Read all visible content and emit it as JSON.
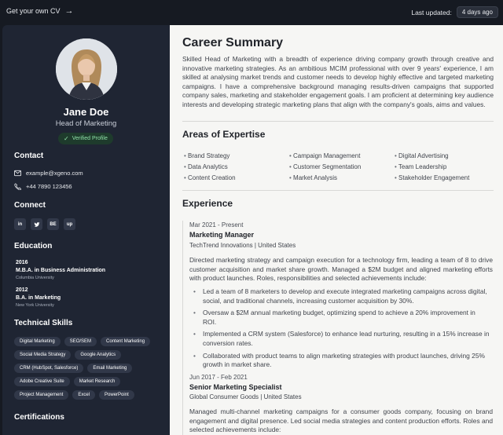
{
  "topbar": {
    "get_cv": "Get your own CV",
    "updated_label": "Last updated:",
    "updated_value": "4 days ago"
  },
  "profile": {
    "name": "Jane Doe",
    "title": "Head of Marketing",
    "verified": "Verified Profile"
  },
  "contact": {
    "heading": "Contact",
    "email": "example@xgeno.com",
    "phone": "+44 7890 123456"
  },
  "connect": {
    "heading": "Connect",
    "links": [
      "in",
      "tw",
      "BE",
      "up"
    ]
  },
  "education": {
    "heading": "Education",
    "items": [
      {
        "year": "2016",
        "degree": "M.B.A. in Business Administration",
        "school": "Columbia University"
      },
      {
        "year": "2012",
        "degree": "B.A. in Marketing",
        "school": "New York University"
      }
    ]
  },
  "skills": {
    "heading": "Technical Skills",
    "items": [
      "Digital Marketing",
      "SEO/SEM",
      "Content Marketing",
      "Social Media Strategy",
      "Google Analytics",
      "CRM (HubSpot, Salesforce)",
      "Email Marketing",
      "Adobe Creative Suite",
      "Market Research",
      "Project Management",
      "Excel",
      "PowerPoint"
    ]
  },
  "certifications": {
    "heading": "Certifications"
  },
  "summary": {
    "heading": "Career Summary",
    "text": "Skilled Head of Marketing with a breadth of experience driving company growth through creative and innovative marketing strategies. As an ambitious MCIM professional with over 9 years' experience, I am skilled at analysing market trends and customer needs to develop highly effective and targeted marketing campaigns. I have a comprehensive background managing results-driven campaigns that supported company sales, marketing and stakeholder engagement goals. I am proficient at determining key audience interests and developing strategic marketing plans that align with the company's goals, aims and values."
  },
  "expertise": {
    "heading": "Areas of Expertise",
    "items": [
      "Brand Strategy",
      "Campaign Management",
      "Digital Advertising",
      "Data Analytics",
      "Customer Segmentation",
      "Team Leadership",
      "Content Creation",
      "Market Analysis",
      "Stakeholder Engagement"
    ]
  },
  "experience": {
    "heading": "Experience",
    "jobs": [
      {
        "period": "Mar 2021 - Present",
        "title": "Marketing Manager",
        "company": "TechTrend Innovations | United States",
        "desc": "Directed marketing strategy and campaign execution for a technology firm, leading a team of 8 to drive customer acquisition and market share growth. Managed a $2M budget and aligned marketing efforts with product launches. Roles, responsibilities and selected achievements include:",
        "bullets": [
          "Led a team of 8 marketers to develop and execute integrated marketing campaigns across digital, social, and traditional channels, increasing customer acquisition by 30%.",
          "Oversaw a $2M annual marketing budget, optimizing spend to achieve a 20% improvement in ROI.",
          "Implemented a CRM system (Salesforce) to enhance lead nurturing, resulting in a 15% increase in conversion rates.",
          "Collaborated with product teams to align marketing strategies with product launches, driving 25% growth in market share."
        ]
      },
      {
        "period": "Jun 2017 - Feb 2021",
        "title": "Senior Marketing Specialist",
        "company": "Global Consumer Goods | United States",
        "desc": "Managed multi-channel marketing campaigns for a consumer goods company, focusing on brand engagement and digital presence. Led social media strategies and content production efforts. Roles and selected achievements include:"
      }
    ]
  }
}
